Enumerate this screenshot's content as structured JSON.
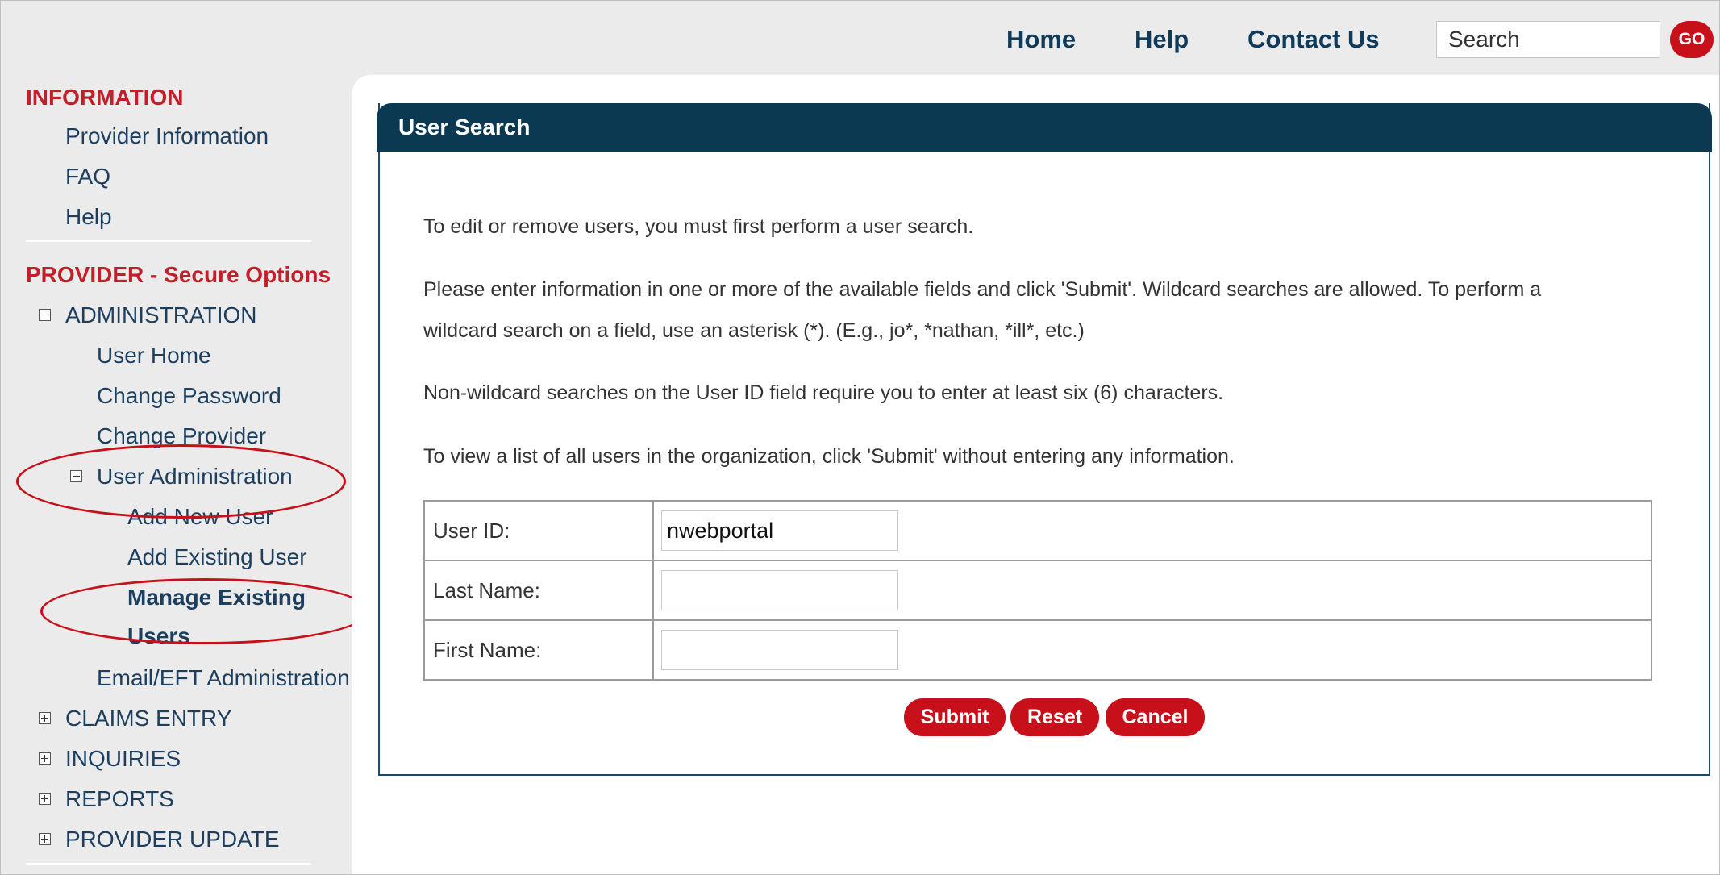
{
  "topnav": {
    "home": "Home",
    "help": "Help",
    "contact_us": "Contact Us",
    "search_value": "Search",
    "go": "GO"
  },
  "sidebar": {
    "information_heading": "INFORMATION",
    "information_items": [
      "Provider Information",
      "FAQ",
      "Help"
    ],
    "provider_heading": "PROVIDER - Secure Options",
    "administration": "ADMINISTRATION",
    "admin_items": [
      "User Home",
      "Change Password",
      "Change Provider"
    ],
    "user_administration": "User Administration",
    "user_admin_items": [
      "Add New User",
      "Add Existing User"
    ],
    "manage_existing_line1": "Manage Existing",
    "manage_existing_line2": "Users",
    "email_eft": "Email/EFT Administration",
    "collapsed_sections": [
      "CLAIMS ENTRY",
      "INQUIRIES",
      "REPORTS",
      "PROVIDER UPDATE"
    ]
  },
  "main": {
    "panel_title": "User Search",
    "paragraphs": [
      "To edit or remove users, you must first perform a user search.",
      "Please enter information in one or more of the available fields and click 'Submit'. Wildcard searches are allowed. To perform a",
      "wildcard search on a field, use an asterisk (*). (E.g., jo*, *nathan, *ill*, etc.)",
      "Non-wildcard searches on the User ID field require you to enter at least six (6) characters.",
      "To view a list of all users in the organization, click 'Submit' without entering any information."
    ],
    "form": {
      "user_id_label": "User ID:",
      "user_id_value": "nwebportal",
      "last_name_label": "Last Name:",
      "last_name_value": "",
      "first_name_label": "First Name:",
      "first_name_value": ""
    },
    "buttons": {
      "submit": "Submit",
      "reset": "Reset",
      "cancel": "Cancel"
    }
  },
  "colors": {
    "accent_red": "#c8101a",
    "panel_header": "#0b3952",
    "nav_link": "#0f3a5a",
    "sidebar_bg": "#ebebeb"
  },
  "icons": {
    "collapse_toggle": "minus-box-icon",
    "expand_toggle": "plus-box-icon"
  }
}
